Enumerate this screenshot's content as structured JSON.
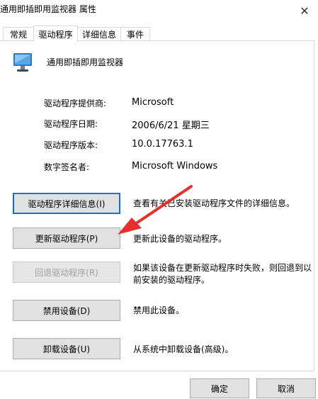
{
  "window": {
    "title": "通用即插即用监视器 属性",
    "close_glyph": "✕"
  },
  "tabs": [
    {
      "label": "常规",
      "active": false
    },
    {
      "label": "驱动程序",
      "active": true
    },
    {
      "label": "详细信息",
      "active": false
    },
    {
      "label": "事件",
      "active": false
    }
  ],
  "device": {
    "name": "通用即插即用监视器",
    "icon": "monitor-icon"
  },
  "properties": [
    {
      "label": "驱动程序提供商:",
      "value": "Microsoft"
    },
    {
      "label": "驱动程序日期:",
      "value": "2006/6/21 星期三"
    },
    {
      "label": "驱动程序版本:",
      "value": "10.0.17763.1"
    },
    {
      "label": "数字签名者:",
      "value": "Microsoft Windows"
    }
  ],
  "actions": [
    {
      "label": "驱动程序详细信息(I)",
      "desc": "查看有关已安装驱动程序文件的详细信息。",
      "state": "focused"
    },
    {
      "label": "更新驱动程序(P)",
      "desc": "更新此设备的驱动程序。",
      "state": "normal"
    },
    {
      "label": "回退驱动程序(R)",
      "desc": "如果该设备在更新驱动程序时失败，则回退到以前安装的驱动程序。",
      "state": "disabled"
    },
    {
      "label": "禁用设备(D)",
      "desc": "禁用此设备。",
      "state": "normal"
    },
    {
      "label": "卸载设备(U)",
      "desc": "从系统中卸载设备(高级)。",
      "state": "normal"
    }
  ],
  "footer": {
    "ok_label": "确定",
    "cancel_label": "取消"
  },
  "annotation": {
    "arrow_color": "#e8302a"
  }
}
